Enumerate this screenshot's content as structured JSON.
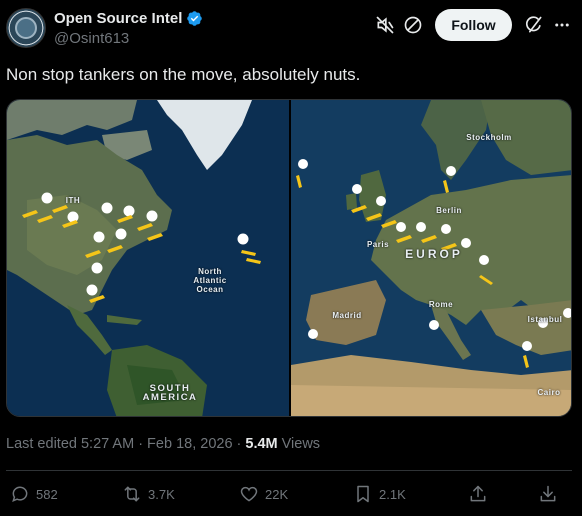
{
  "author": {
    "display_name": "Open Source Intel",
    "handle": "@Osint613",
    "verified": true
  },
  "header_icons": [
    "mute-icon",
    "block-icon",
    "grok-icon"
  ],
  "follow_label": "Follow",
  "tweet_text": "Non stop tankers on the move, absolutely nuts.",
  "media": {
    "left_map": {
      "labels": [
        "North Atlantic Ocean",
        "SOUTH AMERICA",
        "ITH"
      ]
    },
    "right_map": {
      "labels": [
        "Stockholm",
        "Berlin",
        "Paris",
        "EUROP",
        "Rome",
        "Madrid",
        "Istanbul",
        "Cairo"
      ]
    }
  },
  "meta": {
    "edited": "Last edited 5:27 AM · Feb 18, 2026 ·",
    "views_count": "5.4M",
    "views_label": "Views"
  },
  "actions": {
    "replies": "582",
    "reposts": "3.7K",
    "likes": "22K",
    "bookmarks": "2.1K"
  },
  "colors": {
    "accent": "#1d9bf0",
    "follow_bg": "#eff3f4",
    "muted_text": "#71767b",
    "aircraft": "#f5c518"
  }
}
